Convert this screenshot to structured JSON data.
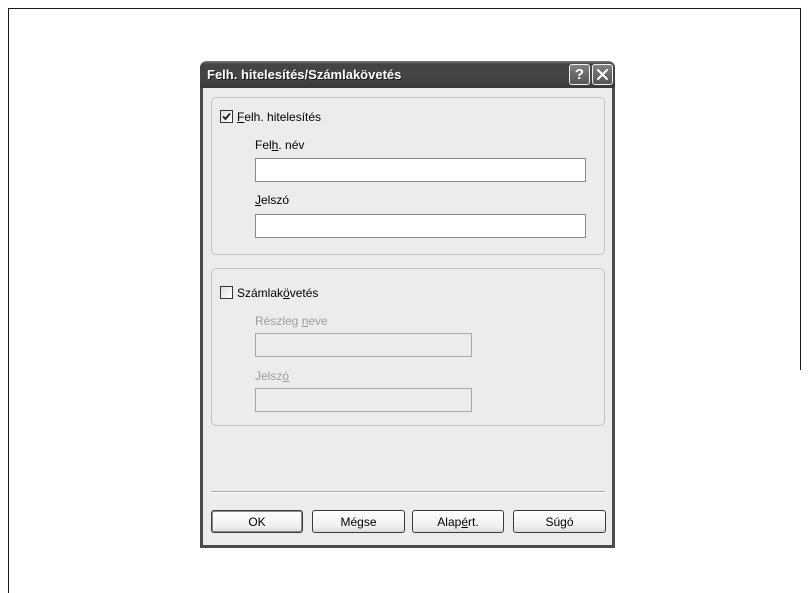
{
  "theme": {
    "title_bar": "#444444",
    "frame": "#4a4a4a",
    "dialog_bg": "#ececec"
  },
  "dialog": {
    "title": "Felh. hitelesítés/Számlakövetés",
    "help_glyph": "?",
    "help_icon": "help-icon",
    "close_icon": "close-icon"
  },
  "user_auth": {
    "checkbox_label": "Felh. hitelesítés",
    "checkbox_mnemonic": "F",
    "checked": true,
    "fields_enabled": true,
    "username_label": "Felh. név",
    "username_mnemonic": "h",
    "username_value": "",
    "password_label": "Jelszó",
    "password_mnemonic": "J",
    "password_value": ""
  },
  "account_tracking": {
    "checkbox_label": "Számlakövetés",
    "checkbox_mnemonic": "ö",
    "checked": false,
    "fields_enabled": false,
    "department_label": "Részleg neve",
    "department_mnemonic": "n",
    "department_value": "",
    "password_label": "Jelszó",
    "password_mnemonic": "ó",
    "password_value": ""
  },
  "buttons": {
    "ok": "OK",
    "cancel": "Mégse",
    "defaults": "Alapért.",
    "defaults_mnemonic": "é",
    "help": "Súgó"
  }
}
